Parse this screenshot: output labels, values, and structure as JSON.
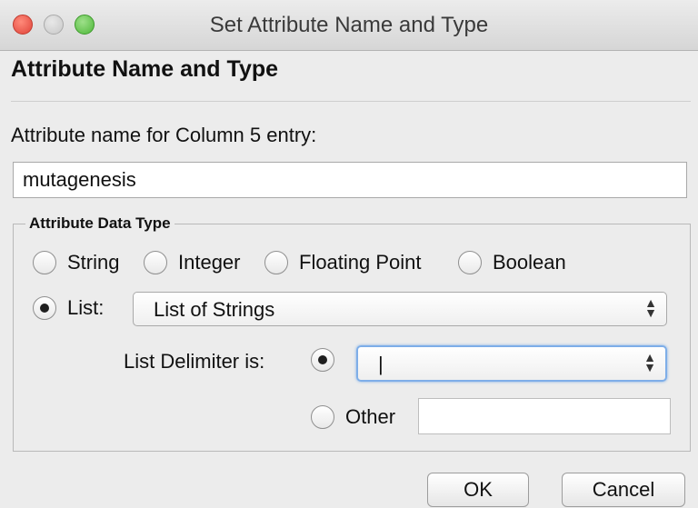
{
  "window": {
    "title": "Set Attribute Name and Type"
  },
  "header": {
    "section_title": "Attribute Name and Type"
  },
  "name_field": {
    "label": "Attribute name for Column 5 entry:",
    "value": "mutagenesis"
  },
  "data_type": {
    "group_label": "Attribute Data Type",
    "options": [
      {
        "label": "String",
        "selected": false
      },
      {
        "label": "Integer",
        "selected": false
      },
      {
        "label": "Floating Point",
        "selected": false
      },
      {
        "label": "Boolean",
        "selected": false
      }
    ],
    "list_option": {
      "label": "List:",
      "selected": true
    },
    "list_type_value": "List of Strings",
    "delimiter_label": "List Delimiter is:",
    "delimiter_value": "|",
    "other_label": "Other",
    "other_value": ""
  },
  "buttons": {
    "ok": "OK",
    "cancel": "Cancel"
  }
}
